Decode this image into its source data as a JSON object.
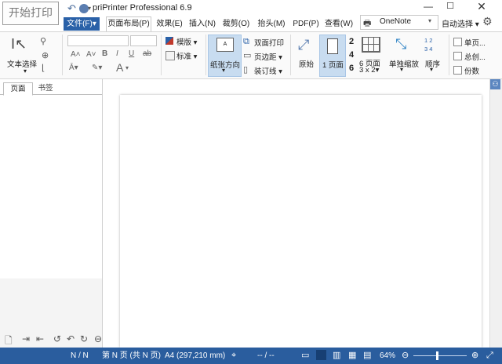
{
  "print_button": "开始打印",
  "app_title": "priPrinter Professional 6.9",
  "tabs": [
    {
      "label": "文件(F)",
      "caret": "▾"
    },
    {
      "label": "页面布局(P)"
    },
    {
      "label": "效果(E)"
    },
    {
      "label": "插入(N)"
    },
    {
      "label": "裁剪(O)"
    },
    {
      "label": "抬头(M)"
    },
    {
      "label": "PDF(P)"
    },
    {
      "label": "查看(W)"
    }
  ],
  "printer": {
    "value": "OneNote"
  },
  "auto_select": "自动选择",
  "ribbon": {
    "text_select": "文本选择",
    "template": "模版",
    "standard": "标准",
    "paper_orientation": "纸张方向",
    "duplex": "双面打印",
    "margins": "页边距",
    "gutter": "装订线",
    "original": "原始",
    "one_page": "1 页面",
    "pages_2": "2",
    "pages_4": "4",
    "pages_6": "6",
    "six_pages": "6 页面",
    "grid": "3 x 2",
    "single_scale": "单独缩放",
    "order": "顺序",
    "order_digits": [
      "1",
      "2",
      "3",
      "4"
    ],
    "single_page": "单页...",
    "total_creation": "总创...",
    "copies": "份数"
  },
  "sidebar_tabs": [
    "页面",
    "书签"
  ],
  "status": {
    "page_count": "N / N",
    "page_info": "第 N 页 (共 N 页)",
    "paper": "A4 (297,210 mm)",
    "coords": "-- / --",
    "zoom": "64%"
  },
  "zoom_level": 0.64,
  "colors": {
    "accent": "#2a61a8",
    "status_bg": "#2a5d9e",
    "highlight": "#c8dcf0"
  }
}
